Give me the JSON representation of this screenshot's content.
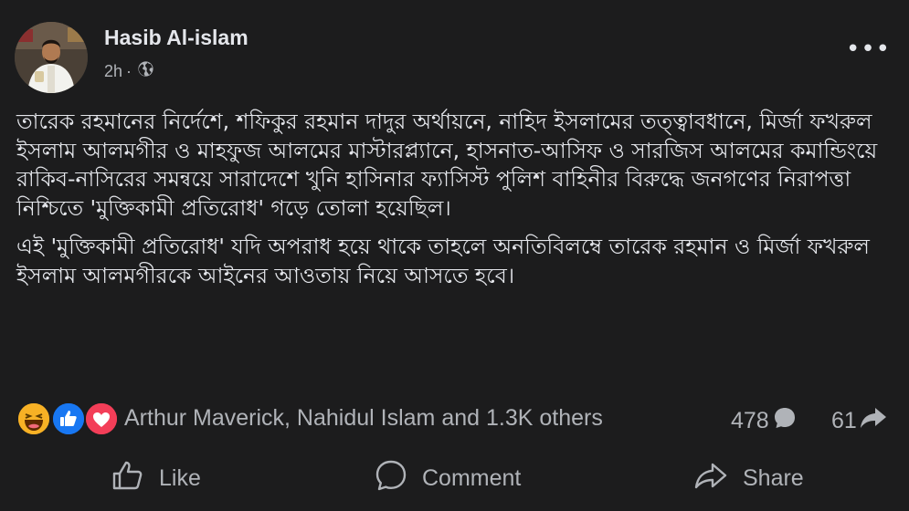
{
  "post": {
    "author": "Hasib Al-islam",
    "time": "2h",
    "separator": "·",
    "privacy_icon": "globe-icon",
    "more_icon": "more-options-icon",
    "more_label": "•••",
    "paragraphs": [
      "তারেক রহমানের নির্দেশে, শফিকুর রহমান দাদুর অর্থায়নে, নাহিদ ইসলামের তত্ত্বাবধানে, মির্জা ফখরুল ইসলাম আলমগীর ও মাহফুজ আলমের মাস্টারপ্ল্যানে, হাসনাত-আসিফ ও সারজিস আলমের কমান্ডিংয়ে রাকিব-নাসিরের সমন্বয়ে সারাদেশে খুনি হাসিনার ফ্যাসিস্ট পুলিশ বাহিনীর বিরুদ্ধে জনগণের নিরাপত্তা নিশ্চিতে 'মুক্তিকামী প্রতিরোধ' গড়ে তোলা হয়েছিল।",
      "এই 'মুক্তিকামী প্রতিরোধ' যদি অপরাধ হয়ে থাকে তাহলে অনতিবিলম্বে তারেক রহমান ও মির্জা ফখরুল ইসলাম আলমগীরকে আইনের আওতায় নিয়ে আসতে হবে।"
    ]
  },
  "reactions": {
    "icons": [
      "haha-icon",
      "like-icon",
      "love-icon"
    ],
    "summary": "Arthur Maverick, Nahidul Islam and 1.3K others"
  },
  "counts": {
    "comments": "478",
    "shares": "61"
  },
  "actions": {
    "like": "Like",
    "comment": "Comment",
    "share": "Share"
  },
  "colors": {
    "background": "#1c1c1d",
    "text_primary": "#e4e6eb",
    "text_secondary": "#b0b3b8",
    "like_blue": "#1877f2",
    "love_red": "#f33e58",
    "haha_yellow": "#f7b125"
  }
}
